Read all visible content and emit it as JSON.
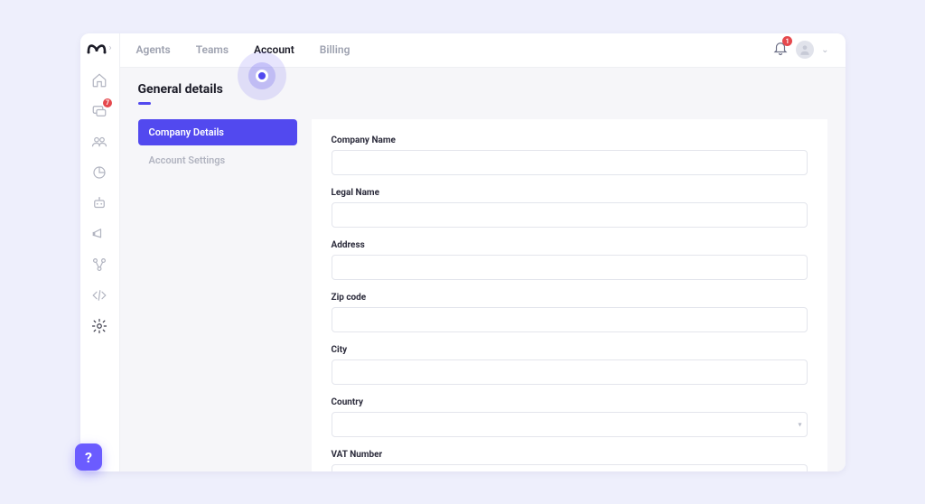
{
  "colors": {
    "accent": "#5249ef",
    "danger": "#e5484d",
    "muted": "#9ea2b0"
  },
  "sidebar": {
    "badge_count": "7",
    "icons": [
      "home-icon",
      "chat-icon",
      "contacts-icon",
      "analytics-icon",
      "bot-icon",
      "campaign-icon",
      "flow-icon",
      "code-icon",
      "settings-icon"
    ]
  },
  "tabs": {
    "items": [
      {
        "label": "Agents",
        "active": false
      },
      {
        "label": "Teams",
        "active": false
      },
      {
        "label": "Account",
        "active": true
      },
      {
        "label": "Billing",
        "active": false
      }
    ]
  },
  "header": {
    "bell_badge": "1"
  },
  "page": {
    "title": "General details"
  },
  "leftMenu": {
    "items": [
      {
        "label": "Company Details",
        "active": true
      },
      {
        "label": "Account Settings",
        "active": false
      }
    ]
  },
  "form": {
    "fields": [
      {
        "label": "Company Name",
        "type": "text",
        "value": ""
      },
      {
        "label": "Legal Name",
        "type": "text",
        "value": ""
      },
      {
        "label": "Address",
        "type": "text",
        "value": ""
      },
      {
        "label": "Zip code",
        "type": "text",
        "value": ""
      },
      {
        "label": "City",
        "type": "text",
        "value": ""
      },
      {
        "label": "Country",
        "type": "select",
        "value": ""
      },
      {
        "label": "VAT Number",
        "type": "text",
        "value": ""
      }
    ]
  },
  "help": {
    "glyph": "?"
  }
}
